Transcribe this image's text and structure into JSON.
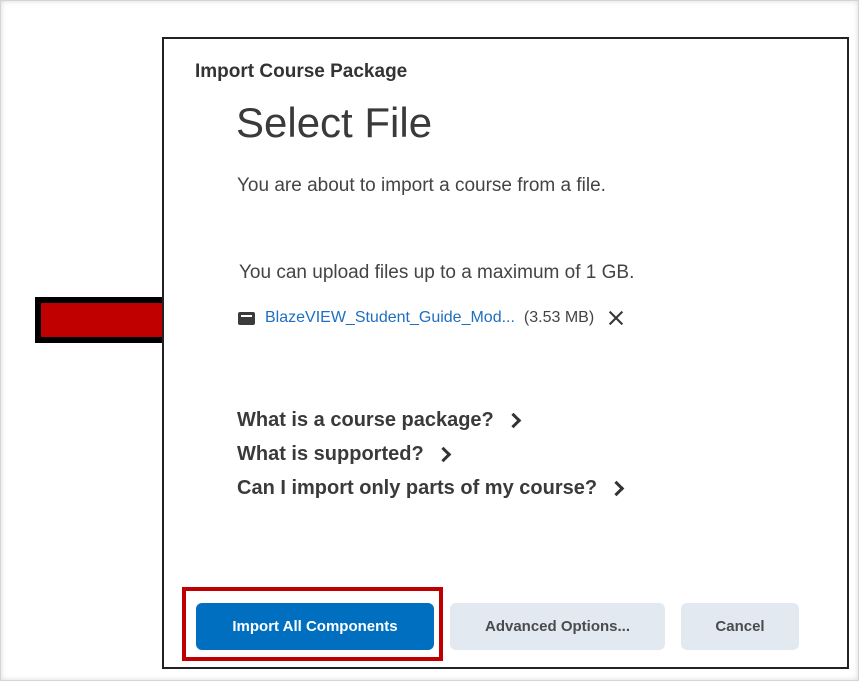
{
  "dialog": {
    "title": "Import Course Package",
    "heading": "Select File",
    "intro": "You are about to import a course from a file.",
    "limit_text": "You can upload files up to a maximum of 1 GB."
  },
  "file": {
    "name": "BlazeVIEW_Student_Guide_Mod...",
    "size": "(3.53 MB)",
    "icon": "file-icon",
    "remove_icon": "close-icon"
  },
  "help_links": [
    {
      "label": "What is a course package?"
    },
    {
      "label": "What is supported?"
    },
    {
      "label": "Can I import only parts of my course?"
    }
  ],
  "buttons": {
    "import_all": "Import All Components",
    "advanced": "Advanced Options...",
    "cancel": "Cancel"
  },
  "colors": {
    "primary": "#006fbf",
    "link": "#1e6fbf",
    "annotation": "#c00000"
  },
  "annotations": {
    "arrow_icon": "arrow-right-icon",
    "highlight": "red outline around Import All Components"
  }
}
